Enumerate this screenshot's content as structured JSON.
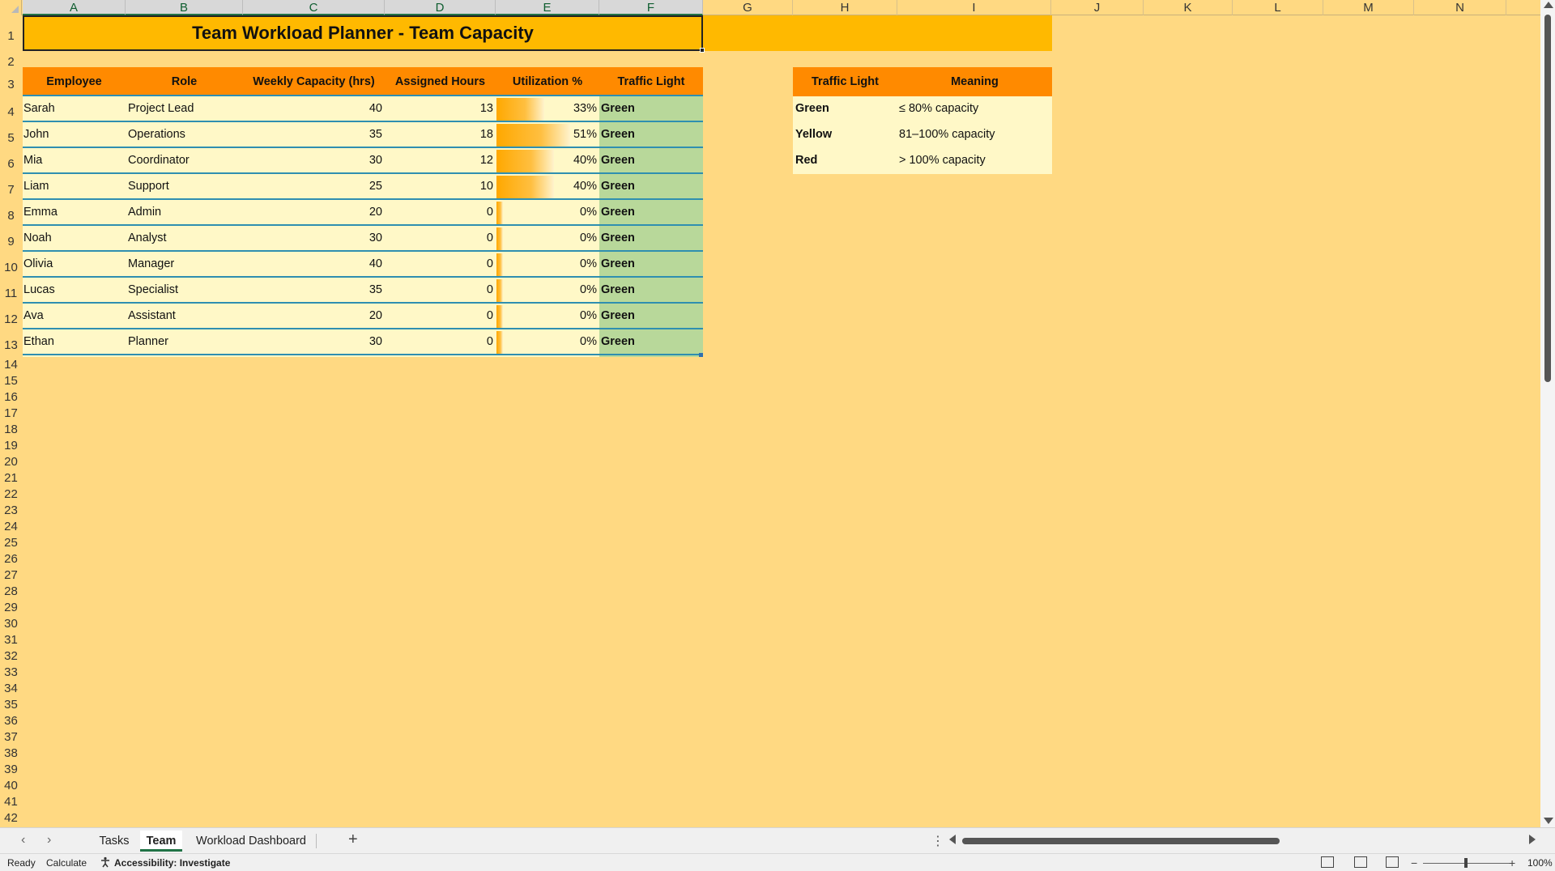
{
  "columns": [
    "A",
    "B",
    "C",
    "D",
    "E",
    "F",
    "G",
    "H",
    "I",
    "J",
    "K",
    "L",
    "M",
    "N"
  ],
  "rows": [
    "1",
    "2",
    "3",
    "4",
    "5",
    "6",
    "7",
    "8",
    "9",
    "10",
    "11",
    "12",
    "13",
    "14",
    "15",
    "16",
    "17",
    "18",
    "19",
    "20",
    "21",
    "22",
    "23",
    "24",
    "25",
    "26",
    "27",
    "28",
    "29",
    "30",
    "31",
    "32",
    "33",
    "34",
    "35",
    "36",
    "37",
    "38",
    "39",
    "40",
    "41",
    "42"
  ],
  "title": "Team Workload Planner - Team Capacity",
  "table": {
    "headers": [
      "Employee",
      "Role",
      "Weekly Capacity (hrs)",
      "Assigned Hours",
      "Utilization %",
      "Traffic Light"
    ],
    "rows": [
      {
        "employee": "Sarah",
        "role": "Project Lead",
        "capacity": "40",
        "assigned": "13",
        "utilization": "33%",
        "light": "Green",
        "util_value": 0.33
      },
      {
        "employee": "John",
        "role": "Operations",
        "capacity": "35",
        "assigned": "18",
        "utilization": "51%",
        "light": "Green",
        "util_value": 0.51
      },
      {
        "employee": "Mia",
        "role": "Coordinator",
        "capacity": "30",
        "assigned": "12",
        "utilization": "40%",
        "light": "Green",
        "util_value": 0.4
      },
      {
        "employee": "Liam",
        "role": "Support",
        "capacity": "25",
        "assigned": "10",
        "utilization": "40%",
        "light": "Green",
        "util_value": 0.4
      },
      {
        "employee": "Emma",
        "role": "Admin",
        "capacity": "20",
        "assigned": "0",
        "utilization": "0%",
        "light": "Green",
        "util_value": 0
      },
      {
        "employee": "Noah",
        "role": "Analyst",
        "capacity": "30",
        "assigned": "0",
        "utilization": "0%",
        "light": "Green",
        "util_value": 0
      },
      {
        "employee": "Olivia",
        "role": "Manager",
        "capacity": "40",
        "assigned": "0",
        "utilization": "0%",
        "light": "Green",
        "util_value": 0
      },
      {
        "employee": "Lucas",
        "role": "Specialist",
        "capacity": "35",
        "assigned": "0",
        "utilization": "0%",
        "light": "Green",
        "util_value": 0
      },
      {
        "employee": "Ava",
        "role": "Assistant",
        "capacity": "20",
        "assigned": "0",
        "utilization": "0%",
        "light": "Green",
        "util_value": 0
      },
      {
        "employee": "Ethan",
        "role": "Planner",
        "capacity": "30",
        "assigned": "0",
        "utilization": "0%",
        "light": "Green",
        "util_value": 0
      }
    ]
  },
  "legend": {
    "headers": [
      "Traffic Light",
      "Meaning"
    ],
    "rows": [
      {
        "light": "Green",
        "meaning": "≤ 80% capacity"
      },
      {
        "light": "Yellow",
        "meaning": "81–100% capacity"
      },
      {
        "light": "Red",
        "meaning": "> 100% capacity"
      }
    ]
  },
  "sheet_tabs": {
    "tabs": [
      "Tasks",
      "Team",
      "Workload Dashboard"
    ],
    "active": "Team"
  },
  "status": {
    "ready": "Ready",
    "calculate": "Calculate",
    "accessibility": "Accessibility: Investigate",
    "zoom": "100%"
  },
  "colors": {
    "sheet_bg": "#ffd982",
    "title_fill": "#ffb900",
    "header_fill": "#ff8a00",
    "row_fill": "#fff8c7",
    "light_fill": "#b8d89a",
    "border": "#2f8fb0",
    "databar": "#ffa800"
  }
}
